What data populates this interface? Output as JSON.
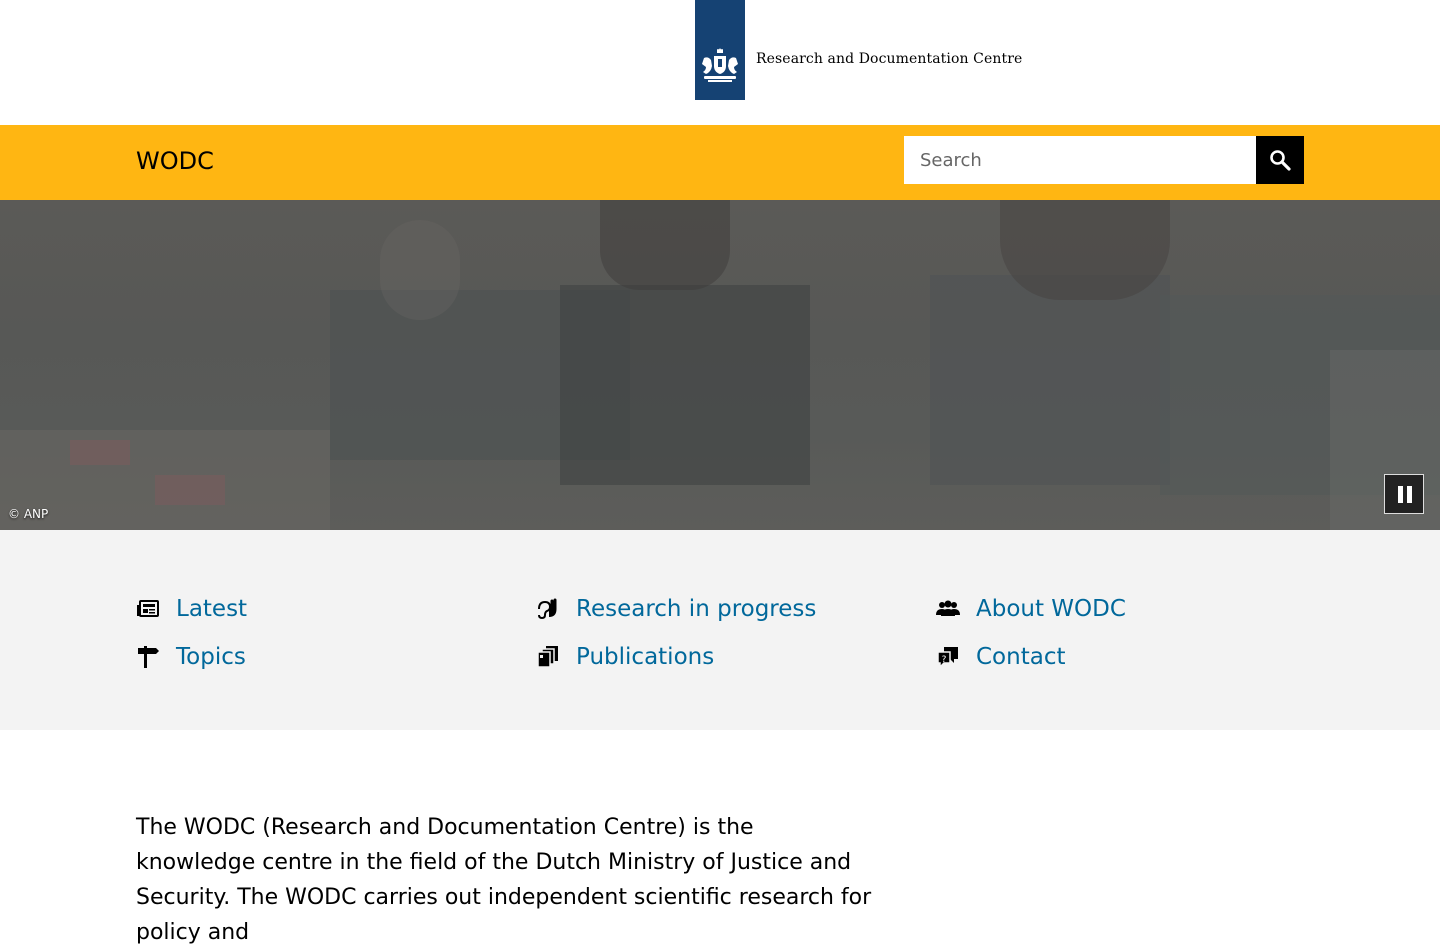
{
  "header": {
    "logo_text": "Research and Documentation Centre",
    "brand_color": "#154273"
  },
  "nav": {
    "site_title": "WODC",
    "bar_color": "#ffb612",
    "search": {
      "placeholder": "Search",
      "value": ""
    },
    "search_button_icon": "search-icon"
  },
  "hero": {
    "credit": "© ANP",
    "pause_icon": "pause-icon"
  },
  "quicklinks": {
    "link_color": "#01689b",
    "items": [
      {
        "label": "Latest",
        "icon": "newspaper-icon"
      },
      {
        "label": "Research in progress",
        "icon": "hand-ear-icon"
      },
      {
        "label": "About WODC",
        "icon": "people-icon"
      },
      {
        "label": "Topics",
        "icon": "signpost-icon"
      },
      {
        "label": "Publications",
        "icon": "documents-icon"
      },
      {
        "label": "Contact",
        "icon": "chat-question-icon"
      }
    ]
  },
  "intro": {
    "text": "The WODC (Research and Documentation Centre) is the knowledge centre in the field of the Dutch Ministry of Justice and Security. The WODC carries out independent scientific research for policy and"
  }
}
